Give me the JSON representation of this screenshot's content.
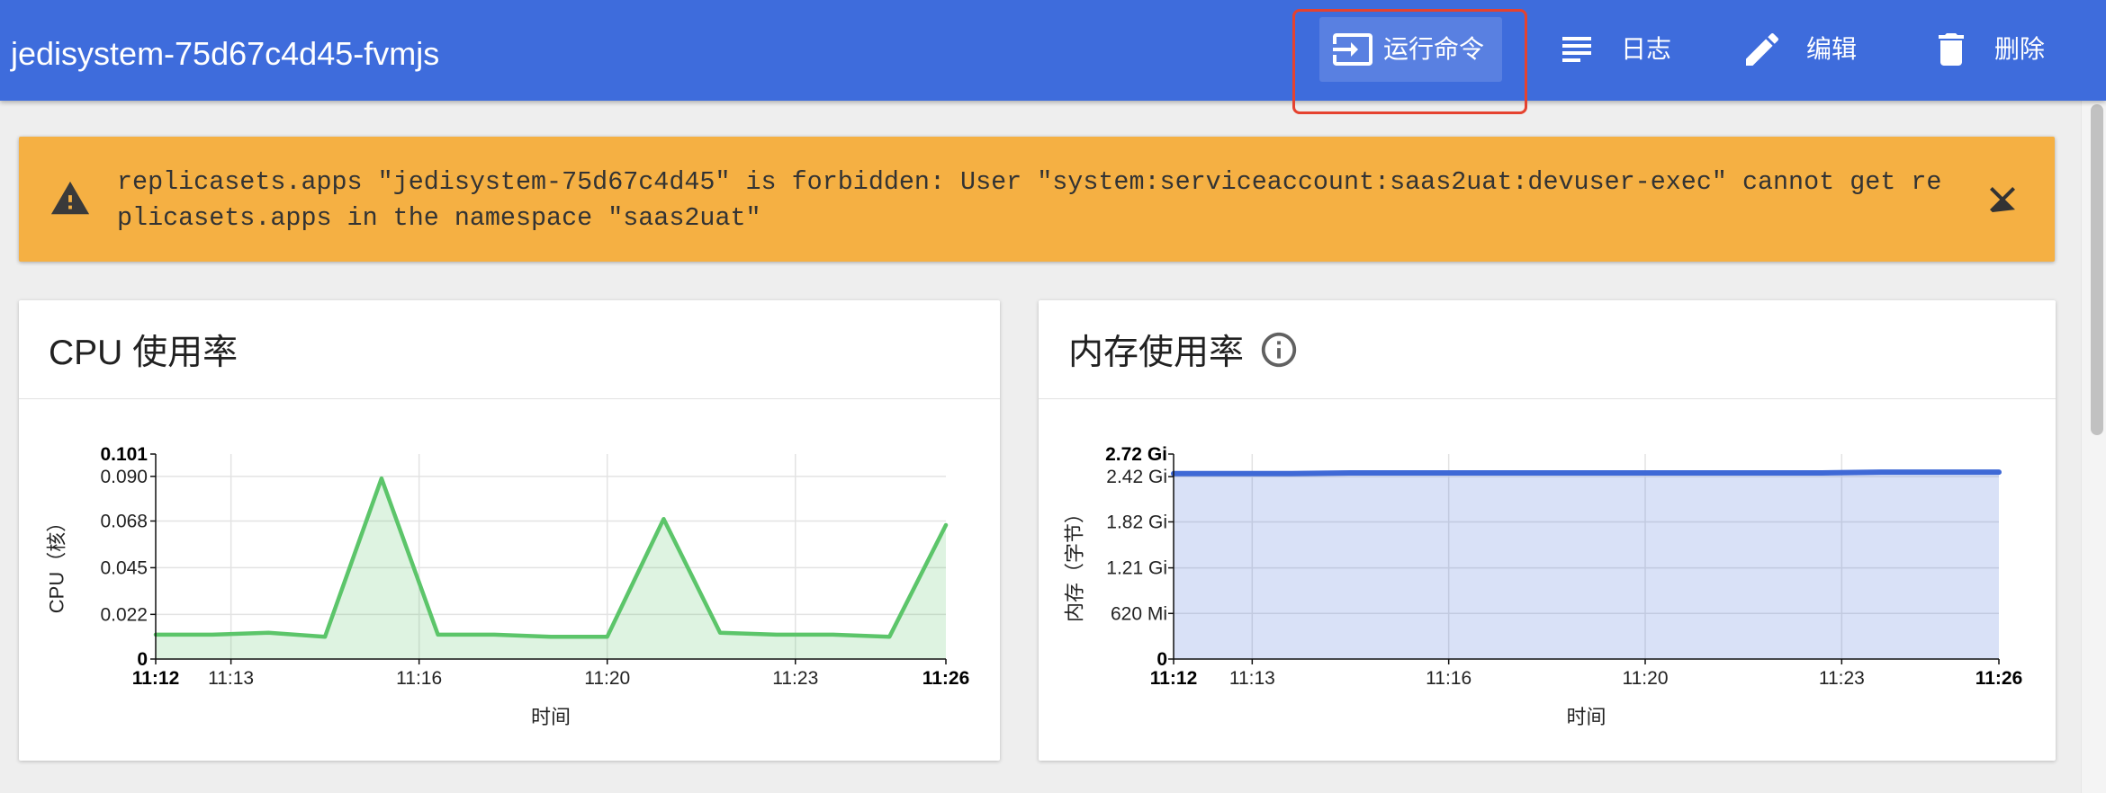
{
  "header": {
    "title": "jedisystem-75d67c4d45-fvmjs",
    "actions": {
      "exec": {
        "label": "运行命令",
        "icon": "input-icon"
      },
      "logs": {
        "label": "日志",
        "icon": "subject-icon"
      },
      "edit": {
        "label": "编辑",
        "icon": "edit-icon"
      },
      "delete": {
        "label": "删除",
        "icon": "delete-icon"
      }
    }
  },
  "alert": {
    "level": "warning",
    "icon": "warning-icon",
    "message": "replicasets.apps \"jedisystem-75d67c4d45\" is forbidden: User \"system:serviceaccount:saas2uat:devuser-exec\" cannot get replicasets.apps in the namespace \"saas2uat\"",
    "close_icon": "close-icon"
  },
  "memory_card": {
    "info_icon": "info-icon"
  },
  "colors": {
    "header": "#3e6cdc",
    "alert": "#f5b043",
    "highlight": "#e5422f"
  },
  "chart_data": [
    {
      "type": "area",
      "title": "CPU 使用率",
      "xlabel": "时间",
      "ylabel": "CPU（核）",
      "x": [
        "11:12",
        "11:13",
        "11:14",
        "11:15",
        "11:16",
        "11:17",
        "11:18",
        "11:19",
        "11:20",
        "11:21",
        "11:22",
        "11:23",
        "11:24",
        "11:25",
        "11:26"
      ],
      "series": [
        {
          "color": "#5cc56a",
          "values": [
            0.012,
            0.012,
            0.013,
            0.011,
            0.089,
            0.012,
            0.012,
            0.011,
            0.011,
            0.069,
            0.013,
            0.012,
            0.012,
            0.011,
            0.066
          ]
        }
      ],
      "xticks": [
        "11:12",
        "11:13",
        "11:16",
        "11:20",
        "11:23",
        "11:26"
      ],
      "yticks": [
        "0",
        "0.022",
        "0.045",
        "0.068",
        "0.090",
        "0.101"
      ],
      "ytick_values": [
        0,
        0.022,
        0.045,
        0.068,
        0.09,
        0.101
      ],
      "ylim": [
        0,
        0.101
      ],
      "grid": true
    },
    {
      "type": "area",
      "title": "内存使用率",
      "xlabel": "时间",
      "ylabel": "内存（字节）",
      "x": [
        "11:12",
        "11:13",
        "11:14",
        "11:15",
        "11:16",
        "11:17",
        "11:18",
        "11:19",
        "11:20",
        "11:21",
        "11:22",
        "11:23",
        "11:24",
        "11:25",
        "11:26"
      ],
      "series": [
        {
          "color": "#3f69d6",
          "values": [
            2.46,
            2.46,
            2.46,
            2.47,
            2.47,
            2.47,
            2.47,
            2.47,
            2.47,
            2.47,
            2.47,
            2.47,
            2.48,
            2.48,
            2.48
          ]
        }
      ],
      "xticks": [
        "11:12",
        "11:13",
        "11:16",
        "11:20",
        "11:23",
        "11:26"
      ],
      "yticks": [
        "0",
        "620 Mi",
        "1.21 Gi",
        "1.82 Gi",
        "2.42 Gi",
        "2.72 Gi"
      ],
      "ytick_values": [
        0,
        0.605,
        1.21,
        1.82,
        2.42,
        2.72
      ],
      "ylim": [
        0,
        2.72
      ],
      "grid": true
    }
  ]
}
